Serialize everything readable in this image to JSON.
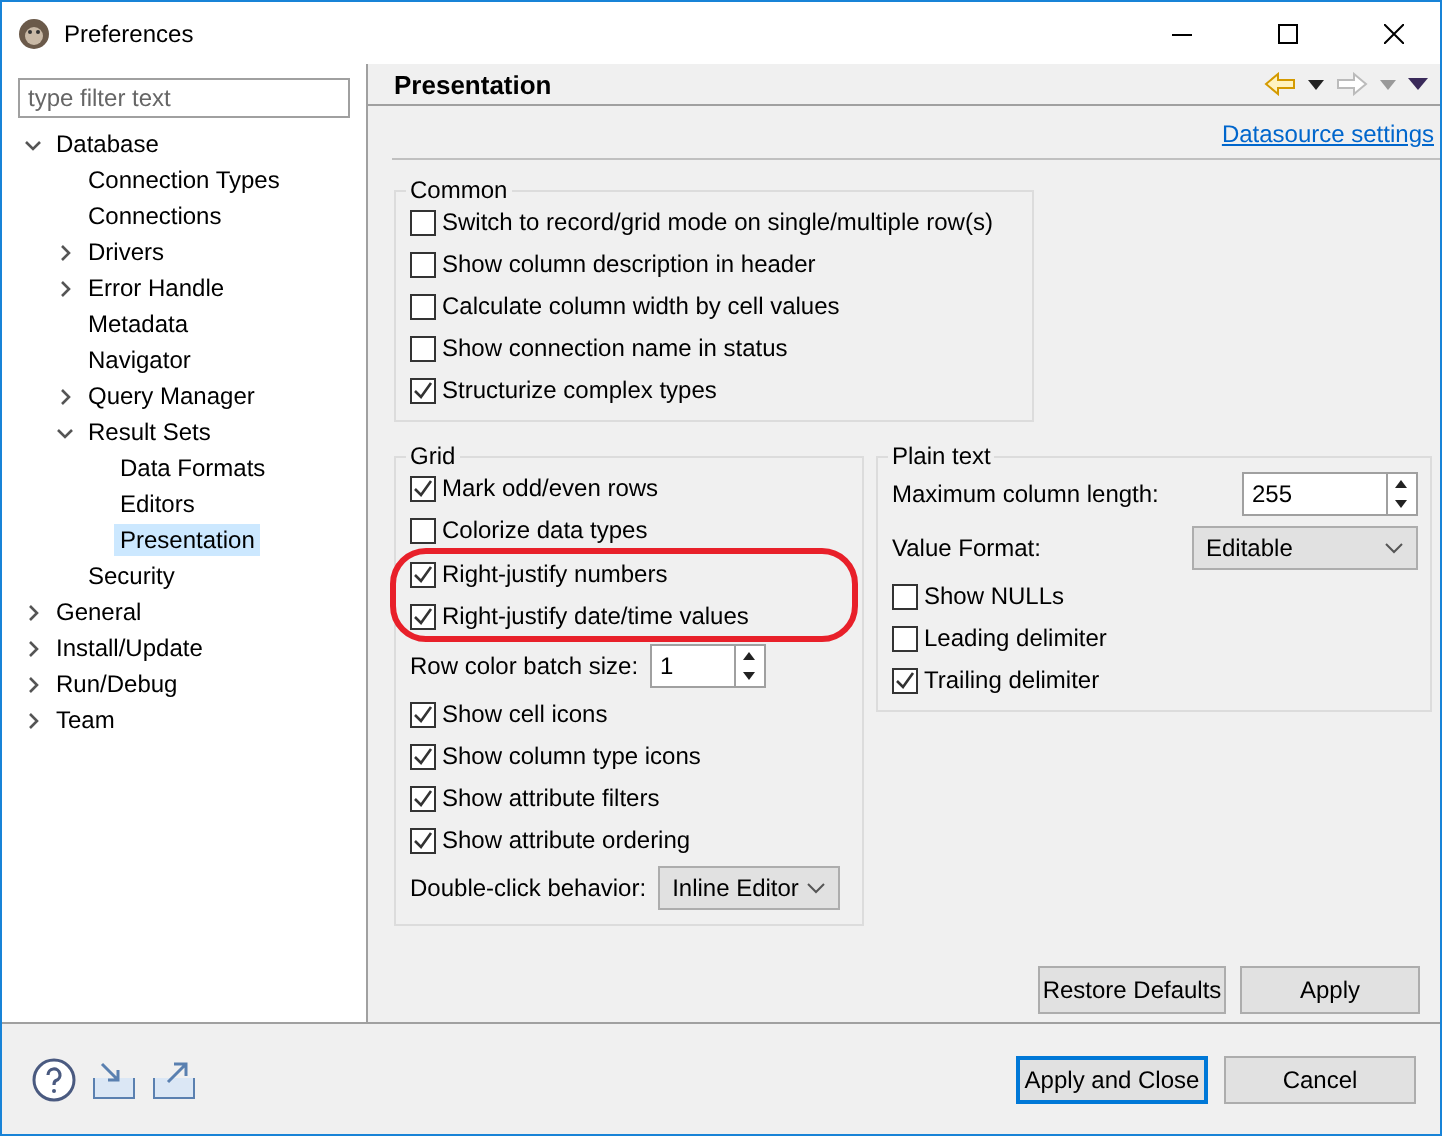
{
  "window": {
    "title": "Preferences"
  },
  "sidebar": {
    "filter": {
      "placeholder": "type filter text"
    },
    "tree": [
      {
        "label": "Database",
        "expanded": true,
        "selected": false,
        "children": [
          {
            "label": "Connection Types",
            "selected": false
          },
          {
            "label": "Connections",
            "selected": false
          },
          {
            "label": "Drivers",
            "expanded": false,
            "selected": false
          },
          {
            "label": "Error Handle",
            "expanded": false,
            "selected": false
          },
          {
            "label": "Metadata",
            "selected": false
          },
          {
            "label": "Navigator",
            "selected": false
          },
          {
            "label": "Query Manager",
            "expanded": false,
            "selected": false
          },
          {
            "label": "Result Sets",
            "expanded": true,
            "selected": false,
            "children": [
              {
                "label": "Data Formats",
                "selected": false
              },
              {
                "label": "Editors",
                "selected": false
              },
              {
                "label": "Presentation",
                "selected": true
              }
            ]
          },
          {
            "label": "Security",
            "selected": false
          }
        ]
      },
      {
        "label": "General",
        "expanded": false,
        "selected": false
      },
      {
        "label": "Install/Update",
        "expanded": false,
        "selected": false
      },
      {
        "label": "Run/Debug",
        "expanded": false,
        "selected": false
      },
      {
        "label": "Team",
        "expanded": false,
        "selected": false
      }
    ]
  },
  "page": {
    "title": "Presentation",
    "link": "Datasource settings",
    "groups": [
      {
        "title": "Common",
        "items": [
          {
            "kind": "checkbox",
            "label": "Switch to record/grid mode on single/multiple row(s)",
            "checked": false
          },
          {
            "kind": "checkbox",
            "label": "Show column description in header",
            "checked": false
          },
          {
            "kind": "checkbox",
            "label": "Calculate column width by cell values",
            "checked": false
          },
          {
            "kind": "checkbox",
            "label": "Show connection name in status",
            "checked": false
          },
          {
            "kind": "checkbox",
            "label": "Structurize complex types",
            "checked": true
          }
        ]
      },
      {
        "title": "Grid",
        "items": [
          {
            "kind": "checkbox",
            "label": "Mark odd/even rows",
            "checked": true,
            "highlighted": false
          },
          {
            "kind": "checkbox",
            "label": "Colorize data types",
            "checked": false,
            "highlighted": false
          },
          {
            "kind": "checkbox",
            "label": "Right-justify numbers",
            "checked": true,
            "highlighted": true
          },
          {
            "kind": "checkbox",
            "label": "Right-justify date/time values",
            "checked": true,
            "highlighted": true
          },
          {
            "kind": "spinner",
            "label": "Row color batch size:",
            "value": "1",
            "highlighted": false
          },
          {
            "kind": "checkbox",
            "label": "Show cell icons",
            "checked": true,
            "highlighted": false
          },
          {
            "kind": "checkbox",
            "label": "Show column type icons",
            "checked": true,
            "highlighted": false
          },
          {
            "kind": "checkbox",
            "label": "Show attribute filters",
            "checked": true,
            "highlighted": false
          },
          {
            "kind": "checkbox",
            "label": "Show attribute ordering",
            "checked": true,
            "highlighted": false
          },
          {
            "kind": "select",
            "label": "Double-click behavior:",
            "value": "Inline Editor",
            "highlighted": false
          }
        ]
      },
      {
        "title": "Plain text",
        "items": [
          {
            "kind": "spinner",
            "label": "Maximum column length:",
            "value": "255"
          },
          {
            "kind": "select",
            "label": "Value Format:",
            "value": "Editable"
          },
          {
            "kind": "checkbox",
            "label": "Show NULLs",
            "checked": false
          },
          {
            "kind": "checkbox",
            "label": "Leading delimiter",
            "checked": false
          },
          {
            "kind": "checkbox",
            "label": "Trailing delimiter",
            "checked": true
          }
        ]
      }
    ],
    "buttons": [
      "Restore Defaults",
      "Apply"
    ]
  },
  "footer": {
    "buttons": [
      {
        "label": "Apply and Close",
        "default": true
      },
      {
        "label": "Cancel",
        "default": false
      }
    ]
  }
}
